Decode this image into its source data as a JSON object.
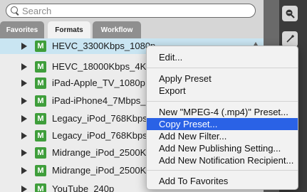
{
  "search": {
    "placeholder": "Search"
  },
  "tabs": [
    {
      "label": "Favorites",
      "active": false
    },
    {
      "label": "Formats",
      "active": true
    },
    {
      "label": "Workflow",
      "active": false
    }
  ],
  "list": {
    "rows": [
      {
        "badge": "M",
        "label": "HEVC_3300Kbps_1080p",
        "selected": true
      },
      {
        "badge": "M",
        "label": "HEVC_18000Kbps_4K",
        "selected": false
      },
      {
        "badge": "M",
        "label": "iPad-Apple_TV_1080p",
        "selected": false
      },
      {
        "badge": "M",
        "label": "iPad-iPhone4_7Mbps_72",
        "selected": false
      },
      {
        "badge": "M",
        "label": "Legacy_iPod_768Kbps_1",
        "selected": false
      },
      {
        "badge": "M",
        "label": "Legacy_iPod_768Kbps_2",
        "selected": false
      },
      {
        "badge": "M",
        "label": "Midrange_iPod_2500Kbp",
        "selected": false
      },
      {
        "badge": "M",
        "label": "Midrange_iPod_2500Kbp",
        "selected": false
      },
      {
        "badge": "M",
        "label": "YouTube_240p",
        "selected": false
      }
    ]
  },
  "context_menu": {
    "items": [
      {
        "label": "Edit..."
      },
      {
        "label": "Apply Preset"
      },
      {
        "label": "Export"
      },
      {
        "label": "New \"MPEG-4 (.mp4)\" Preset..."
      },
      {
        "label": "Copy Preset...",
        "highlighted": true
      },
      {
        "label": "Add New Filter..."
      },
      {
        "label": "Add New Publishing Setting..."
      },
      {
        "label": "Add New Notification Recipient..."
      },
      {
        "label": "Add To Favorites"
      }
    ]
  },
  "toolbar": {
    "tools": [
      {
        "icon": "zoom-out-icon"
      },
      {
        "icon": "eyedropper-icon"
      }
    ]
  },
  "colors": {
    "selection": "#c9e5f2",
    "menu_highlight": "#2a62e6",
    "badge": "#3f9e3b"
  }
}
